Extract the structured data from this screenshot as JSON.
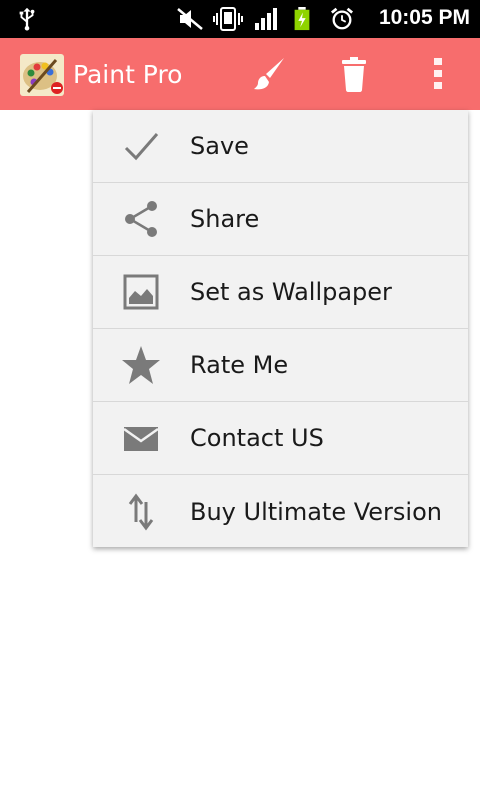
{
  "status_bar": {
    "time": "10:05 PM",
    "icons": [
      "usb-icon",
      "mute-icon",
      "vibrate-icon",
      "signal-icon",
      "battery-charging-icon",
      "alarm-icon"
    ]
  },
  "action_bar": {
    "app_title": "Paint Pro",
    "background": "#f76d6d",
    "actions": [
      "brush-icon",
      "trash-icon",
      "overflow-menu-icon"
    ]
  },
  "menu": {
    "items": [
      {
        "label": "Save",
        "icon": "check-icon"
      },
      {
        "label": "Share",
        "icon": "share-icon"
      },
      {
        "label": "Set as Wallpaper",
        "icon": "image-icon"
      },
      {
        "label": "Rate Me",
        "icon": "star-icon"
      },
      {
        "label": "Contact US",
        "icon": "mail-icon"
      },
      {
        "label": "Buy Ultimate Version",
        "icon": "swap-arrows-icon"
      }
    ]
  }
}
